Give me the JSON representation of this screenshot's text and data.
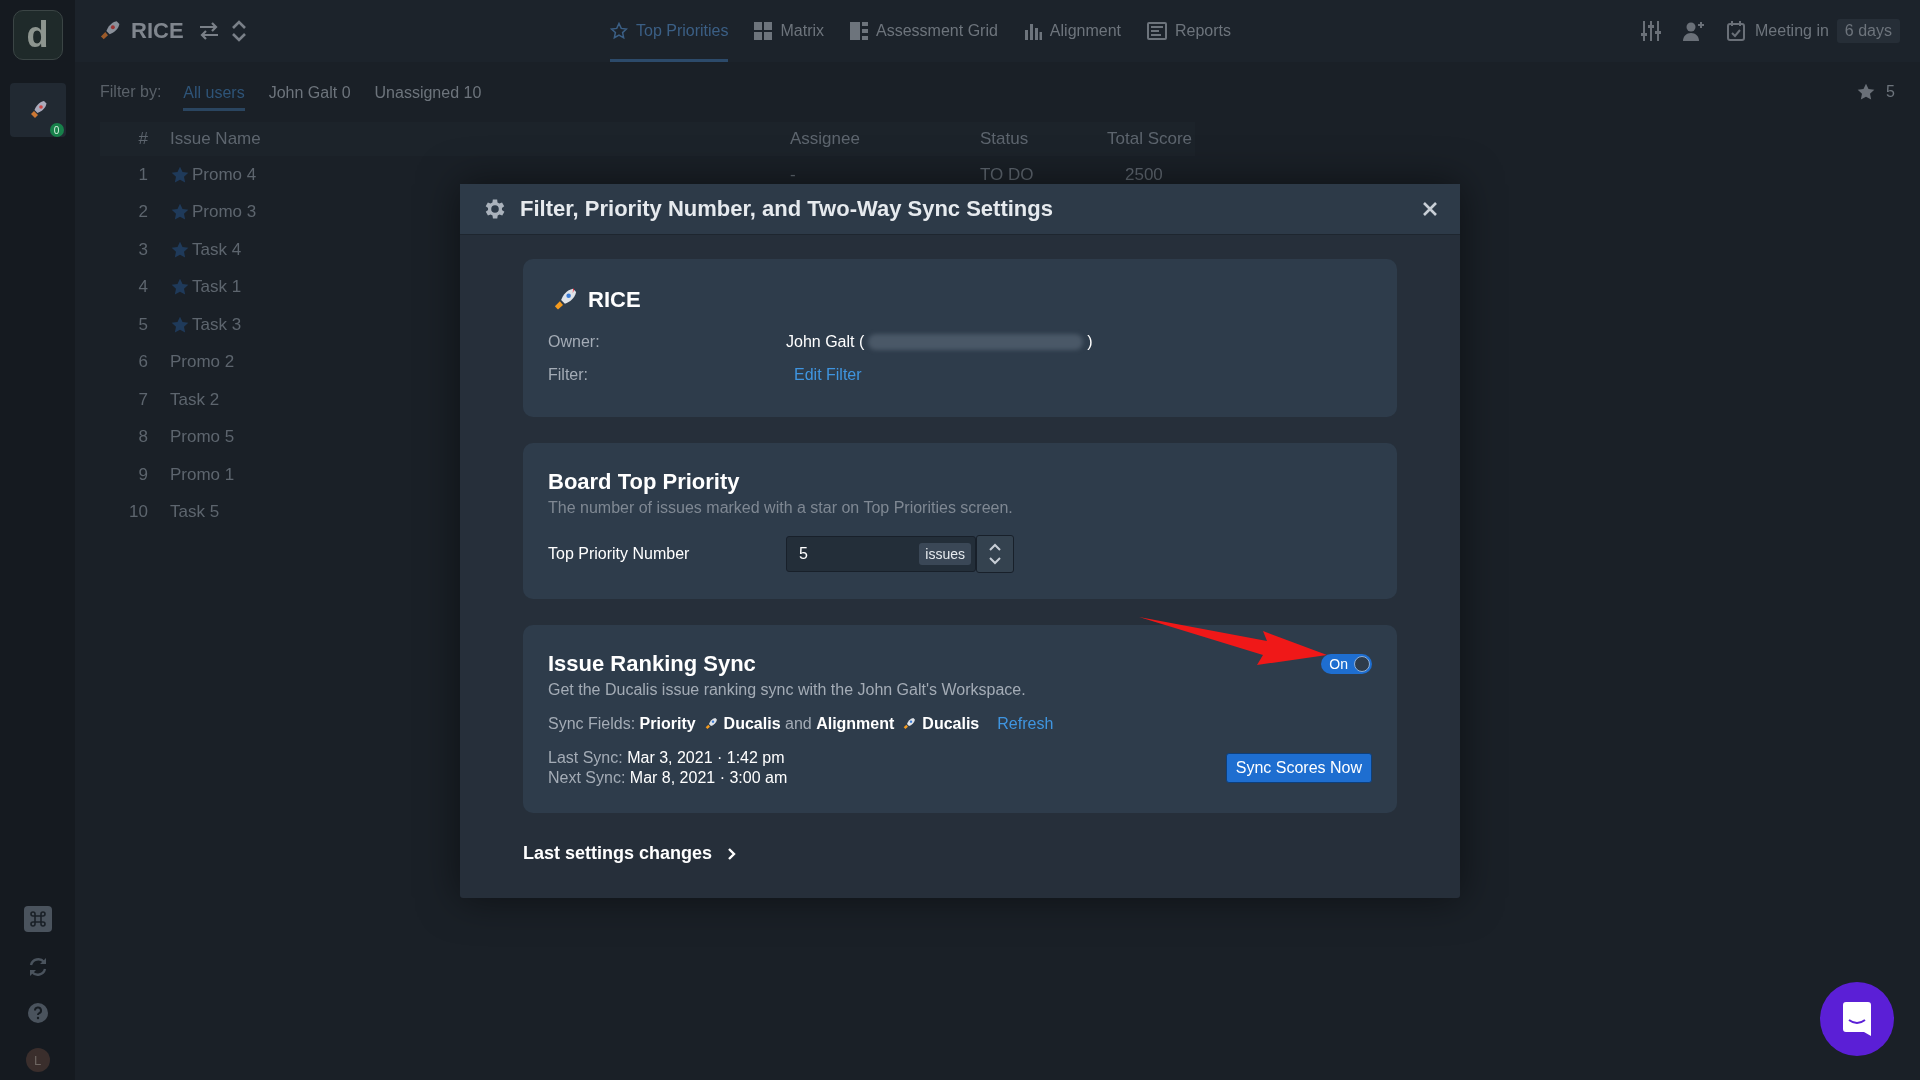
{
  "logo": "d",
  "board": {
    "title": "RICE"
  },
  "nav_tabs": [
    {
      "label": "Top Priorities",
      "selected": true
    },
    {
      "label": "Matrix",
      "selected": false
    },
    {
      "label": "Assessment Grid",
      "selected": false
    },
    {
      "label": "Alignment",
      "selected": false
    },
    {
      "label": "Reports",
      "selected": false
    }
  ],
  "meeting": {
    "label": "Meeting in",
    "badge": "6 days"
  },
  "sidebar": {
    "board_badge": "0",
    "avatar": "L"
  },
  "filter": {
    "label": "Filter by:",
    "options": [
      {
        "label": "All users",
        "selected": true
      },
      {
        "label": "John Galt 0",
        "selected": false
      },
      {
        "label": "Unassigned 10",
        "selected": false
      }
    ],
    "star_count": "5"
  },
  "table": {
    "columns": [
      "#",
      "Issue Name",
      "Assignee",
      "Status",
      "Total Score"
    ],
    "rows": [
      {
        "num": "1",
        "name": "Promo 4",
        "starred": true,
        "assignee": "-",
        "status": "TO DO",
        "score": "2500"
      },
      {
        "num": "2",
        "name": "Promo 3",
        "starred": true
      },
      {
        "num": "3",
        "name": "Task 4",
        "starred": true
      },
      {
        "num": "4",
        "name": "Task 1",
        "starred": true
      },
      {
        "num": "5",
        "name": "Task 3",
        "starred": true
      },
      {
        "num": "6",
        "name": "Promo 2",
        "starred": false
      },
      {
        "num": "7",
        "name": "Task 2",
        "starred": false
      },
      {
        "num": "8",
        "name": "Promo 5",
        "starred": false
      },
      {
        "num": "9",
        "name": "Promo 1",
        "starred": false
      },
      {
        "num": "10",
        "name": "Task 5",
        "starred": false
      }
    ]
  },
  "modal": {
    "title": "Filter, Priority Number, and Two-Way Sync Settings",
    "board_card": {
      "title": "RICE",
      "owner_label": "Owner:",
      "owner_prefix": "John Galt (",
      "owner_suffix": ")",
      "filter_label": "Filter:",
      "filter_link": "Edit Filter"
    },
    "priority_card": {
      "title": "Board Top Priority",
      "description": "The number of issues marked with a star on Top Priorities screen.",
      "field_label": "Top Priority Number",
      "value": "5",
      "unit": "issues"
    },
    "sync_card": {
      "title": "Issue Ranking Sync",
      "toggle": {
        "on": true,
        "label": "On"
      },
      "description": "Get the Ducalis issue ranking sync with the John Galt's Workspace.",
      "fields_segments": [
        "Sync Fields: **Priority**",
        "**Ducalis** and **Alignment**",
        "**Ducalis**"
      ],
      "refresh": "Refresh",
      "last_sync_label": "Last Sync:",
      "last_sync": "Mar 3, 2021 · 1:42 pm",
      "next_sync_label": "Next Sync:",
      "next_sync": "Mar 8, 2021 · 3:00 am",
      "button": "Sync Scores Now"
    },
    "last_changes": "Last settings changes"
  }
}
